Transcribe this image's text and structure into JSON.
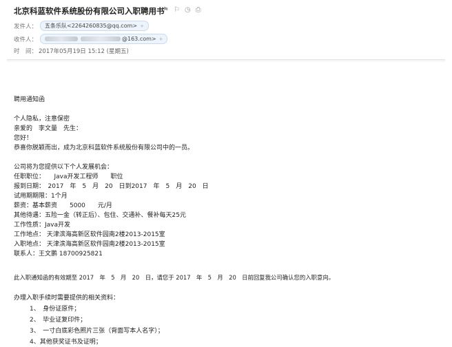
{
  "email": {
    "subject": "北京科蓝软件系统股份有限公司入职聘用书",
    "from_label": "发件人：",
    "from_value": "五条乐队<2264260835@qq.com>",
    "to_label": "收件人：",
    "to_value": "@163.com>",
    "time_label": "时　间：",
    "time_value": "2017年05月19日 15:12 (星期五)"
  },
  "body": {
    "lines": [
      "聘用通知函",
      "个人隐私，注意保密",
      "亲爱的　李文量　先生：",
      "您好！",
      "恭喜你脱颖而出，成为北京科蓝软件系统股份有限公司中的一员。",
      "公司将为您提供以下个人发展机会：",
      "任职职位：　　Java开发工程师　　职位",
      "报到日期：　2017　年　5　月　20　日到2017　年　5　月　20　日",
      "试用期期限：1个月",
      "薪资：基本薪资　　5000　　元/月",
      "其他待遇：五险一金（转正后）、包住、交通补、餐补每天25元",
      "工作性质：Java开发",
      "工作地点： 天津滨海高新区软件园南2楼2013-2015室",
      "入职地点： 天津滨海高新区软件园南2楼2013-2015室",
      "联系人：王文鹏 18700925821",
      "此入职通知函的有效期至 2017　年　5　月　20　日，请您于 2017　年　5　月　20　日前回复我公司确认您的入职意向。",
      "办理入职手续时需要提供的相关资料：",
      "　1、　身份证原件；",
      "　2、　毕业证复印件；",
      "　3、　一寸白底彩色照片三张（背面写本人名字）；",
      "　4、其他获奖证书及证明；"
    ]
  }
}
